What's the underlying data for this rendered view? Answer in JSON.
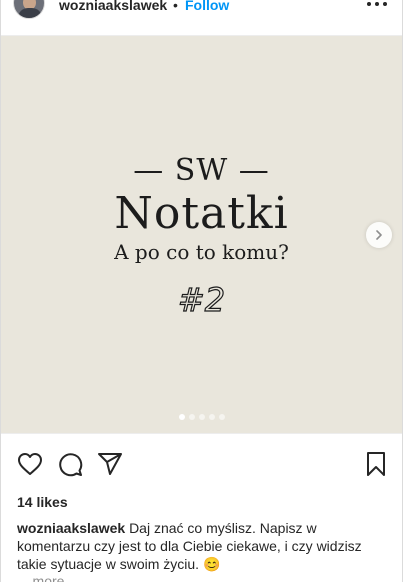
{
  "header": {
    "username": "wozniaakslawek",
    "separator": "•",
    "follow_label": "Follow"
  },
  "slide": {
    "line1": "— SW —",
    "line2": "Notatki",
    "line3": "A po co to komu?",
    "line4": "#2",
    "background_color": "#e9e6dc",
    "dot_count": 5,
    "active_dot": 1
  },
  "footer": {
    "likes_text": "14 likes",
    "caption_user": "wozniaakslawek",
    "caption_text": "Daj znać co myślisz. Napisz w komentarzu czy jest to dla Ciebie ciekawe, i czy widzisz takie sytuacje w swoim życiu. 😊",
    "more_label": "... more"
  },
  "colors": {
    "accent": "#0095f6",
    "text": "#262626",
    "muted": "#8e8e8e"
  }
}
